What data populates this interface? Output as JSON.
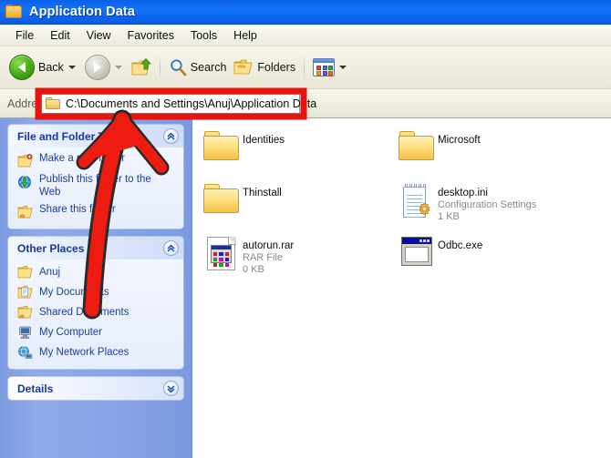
{
  "window": {
    "title": "Application Data",
    "title_icon": "folder-icon"
  },
  "menu": {
    "items": [
      "File",
      "Edit",
      "View",
      "Favorites",
      "Tools",
      "Help"
    ]
  },
  "toolbar": {
    "back_label": "Back",
    "back_icon": "back-arrow-icon",
    "forward_icon": "forward-arrow-icon",
    "up_icon": "up-one-level-icon",
    "search_label": "Search",
    "search_icon": "search-icon",
    "folders_label": "Folders",
    "folders_icon": "folders-icon",
    "views_icon": "views-icon"
  },
  "address": {
    "label": "Address",
    "path": "C:\\Documents and Settings\\Anuj\\Application Data",
    "icon": "folder-icon",
    "highlight_color": "#e8140c"
  },
  "sidebar": {
    "panels": [
      {
        "title": "File and Folder Tasks",
        "collapse_icon": "chevron-up-icon",
        "collapsed": false,
        "items": [
          {
            "label": "Make a new folder",
            "icon": "new-folder-icon"
          },
          {
            "label": "Publish this folder to the Web",
            "icon": "publish-web-icon"
          },
          {
            "label": "Share this folder",
            "icon": "share-folder-icon"
          }
        ]
      },
      {
        "title": "Other Places",
        "collapse_icon": "chevron-up-icon",
        "collapsed": false,
        "items": [
          {
            "label": "Anuj",
            "icon": "folder-icon"
          },
          {
            "label": "My Documents",
            "icon": "my-documents-icon"
          },
          {
            "label": "Shared Documents",
            "icon": "shared-documents-icon"
          },
          {
            "label": "My Computer",
            "icon": "my-computer-icon"
          },
          {
            "label": "My Network Places",
            "icon": "network-places-icon"
          }
        ]
      },
      {
        "title": "Details",
        "collapse_icon": "chevron-down-icon",
        "collapsed": true,
        "items": []
      }
    ]
  },
  "files": [
    {
      "name": "Identities",
      "type": "folder",
      "icon": "folder-icon",
      "desc": "",
      "size": ""
    },
    {
      "name": "Microsoft",
      "type": "folder",
      "icon": "folder-icon",
      "desc": "",
      "size": ""
    },
    {
      "name": "Thinstall",
      "type": "folder",
      "icon": "folder-icon",
      "desc": "",
      "size": ""
    },
    {
      "name": "desktop.ini",
      "type": "file",
      "icon": "config-file-icon",
      "desc": "Configuration Settings",
      "size": "1 KB"
    },
    {
      "name": "autorun.rar",
      "type": "file",
      "icon": "generic-file-icon",
      "desc": "RAR File",
      "size": "0 KB"
    },
    {
      "name": "Odbc.exe",
      "type": "file",
      "icon": "application-icon",
      "desc": "",
      "size": ""
    }
  ],
  "annotation": {
    "arrow_icon": "red-arrow-annotation",
    "arrow_color": "#ee1b10",
    "arrow_outline": "#2b2b2b"
  }
}
